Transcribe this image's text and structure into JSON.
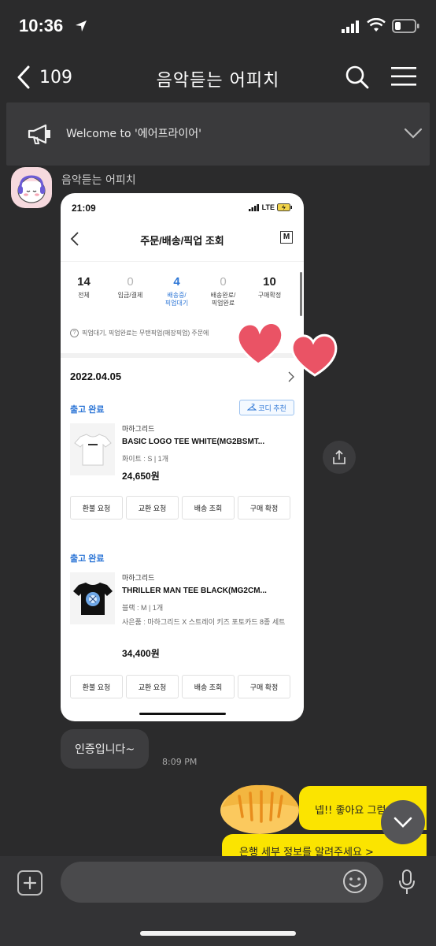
{
  "status_bar": {
    "time": "10:36"
  },
  "nav": {
    "back_count": "109",
    "title": "음악듣는 어피치"
  },
  "notice": {
    "text": "Welcome to '에어프라이어'"
  },
  "message": {
    "sender": "음악듣는 어피치",
    "shot": {
      "time": "21:09",
      "network": "LTE",
      "title": "주문/배송/픽업 조회",
      "m_label": "M",
      "stats": [
        {
          "count": "14",
          "label": "전체"
        },
        {
          "count": "0",
          "label": "입금/결제"
        },
        {
          "count": "4",
          "label": "배송중/",
          "label2": "픽업대기"
        },
        {
          "count": "0",
          "label": "배송완료/",
          "label2": "픽업완료"
        },
        {
          "count": "10",
          "label": "구매확정"
        }
      ],
      "pickup_note": "픽업대기, 픽업완료는 무탠픽업(매장픽업) 주문에",
      "date": "2022.04.05",
      "orders": [
        {
          "status": "출고 완료",
          "coordi": "코디 추천",
          "brand": "마하그리드",
          "name": "BASIC LOGO TEE WHITE(MG2BSMT...",
          "option": "화이트 : S  |  1개",
          "price": "24,650원",
          "actions": [
            "환불 요청",
            "교환 요청",
            "배송 조회",
            "구매 확정"
          ]
        },
        {
          "status": "출고 완료",
          "brand": "마하그리드",
          "name": "THRILLER MAN TEE BLACK(MG2CM...",
          "option": "블랙 : M  |  1개",
          "gift": "사은품 : 마하그리드 X 스트레이 키즈 포토카드 8종 세트",
          "price": "34,400원",
          "actions": [
            "환불 요청",
            "교환 요청",
            "배송 조회",
            "구매 확정"
          ]
        }
      ]
    }
  },
  "reply": {
    "text": "인증입니다~",
    "time": "8:09 PM"
  },
  "my_messages": [
    "넵!! 좋아요 그럼",
    "은행 세부 정보를 알려주세요 >"
  ],
  "colors": {
    "background": "#2b2b2c",
    "accent_blue": "#2d76d6",
    "my_bubble": "#fbe400"
  },
  "input": {
    "placeholder": ""
  }
}
